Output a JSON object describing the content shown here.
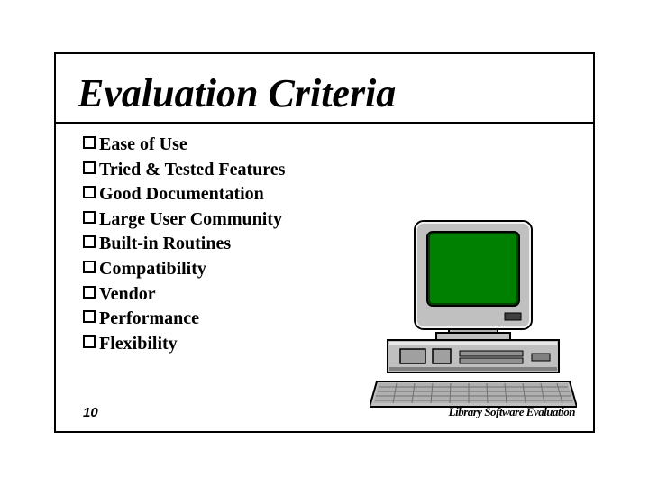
{
  "title": "Evaluation Criteria",
  "items": [
    "Ease of Use",
    "Tried & Tested Features",
    "Good Documentation",
    "Large User Community",
    "Built-in Routines",
    "Compatibility",
    "Vendor",
    "Performance",
    "Flexibility"
  ],
  "page_number": "10",
  "footer_label": "Library Software Evaluation"
}
